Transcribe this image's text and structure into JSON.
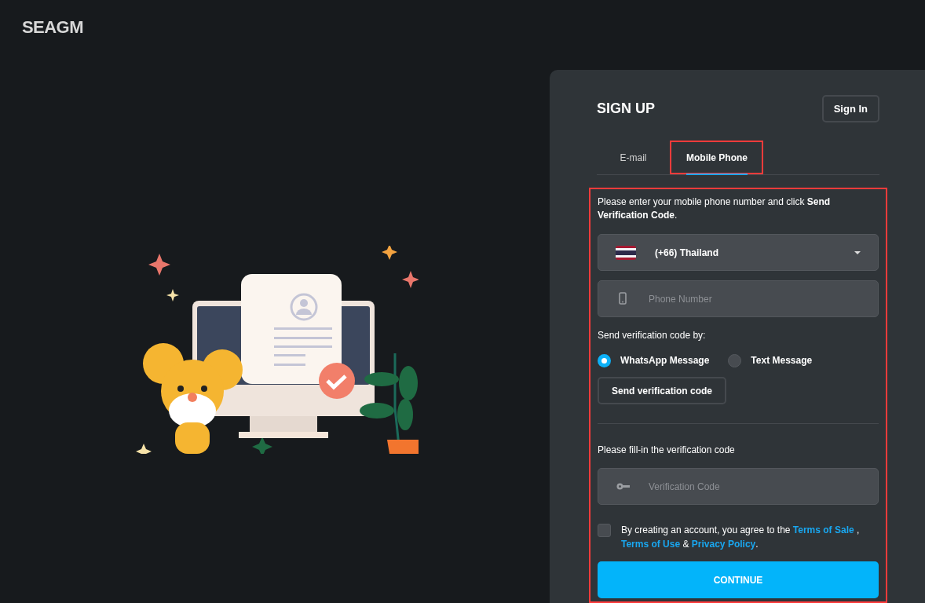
{
  "logo": "SEAGM",
  "form": {
    "title": "SIGN UP",
    "sign_in_button": "Sign In",
    "tabs": [
      {
        "label": "E-mail",
        "selected": false,
        "highlighted": false
      },
      {
        "label": "Mobile Phone",
        "selected": true,
        "highlighted": true
      }
    ],
    "instruction": "Please enter your mobile phone number and click **Send Verification Code**.",
    "country_select": {
      "value": "(+66) Thailand"
    },
    "phone_field": {
      "placeholder": "Phone Number"
    },
    "method_label": "Send verification code by:",
    "methods": [
      {
        "label": "WhatsApp Message",
        "selected": true
      },
      {
        "label": "Text Message",
        "selected": false
      }
    ],
    "send_button": "Send verification code",
    "code_label": "Please fill-in the verification code",
    "code_field": {
      "placeholder": "Verification Code"
    },
    "agreement": {
      "checked": false,
      "parts": [
        {
          "kind": "text",
          "text": "By creating an account, you agree to the"
        },
        {
          "kind": "link",
          "text": "Terms of Sale"
        },
        {
          "kind": "text",
          "text": ","
        },
        {
          "kind": "link",
          "text": "Terms of Use"
        },
        {
          "kind": "text",
          "text": "&"
        },
        {
          "kind": "link",
          "text": "Privacy Policy"
        },
        {
          "kind": "text",
          "text": "."
        }
      ]
    },
    "continue_button": "CONTINUE",
    "highlighted": true
  }
}
